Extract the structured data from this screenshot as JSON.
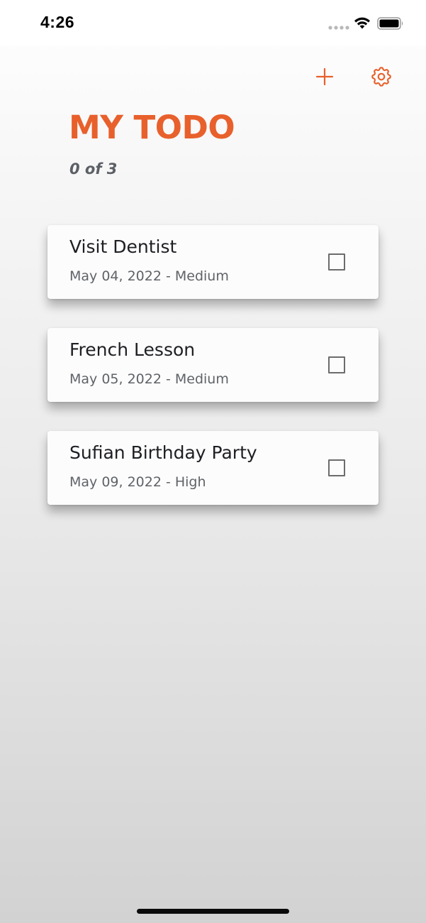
{
  "status_bar": {
    "time": "4:26",
    "icons": [
      "signal-dots-icon",
      "wifi-icon",
      "battery-icon"
    ]
  },
  "toolbar": {
    "add_icon": "plus-icon",
    "settings_icon": "gear-icon"
  },
  "header": {
    "title": "MY TODO",
    "progress": "0 of 3"
  },
  "todos": [
    {
      "title": "Visit Dentist",
      "meta": "May 04, 2022 - Medium",
      "checked": false
    },
    {
      "title": "French Lesson",
      "meta": "May 05, 2022 - Medium",
      "checked": false
    },
    {
      "title": "Sufian Birthday Party",
      "meta": "May 09, 2022 - High",
      "checked": false
    }
  ],
  "colors": {
    "accent": "#e8602c",
    "title_text": "#1d1f23",
    "meta_text": "#5f6368",
    "checkbox_border": "#6c6c6c"
  }
}
